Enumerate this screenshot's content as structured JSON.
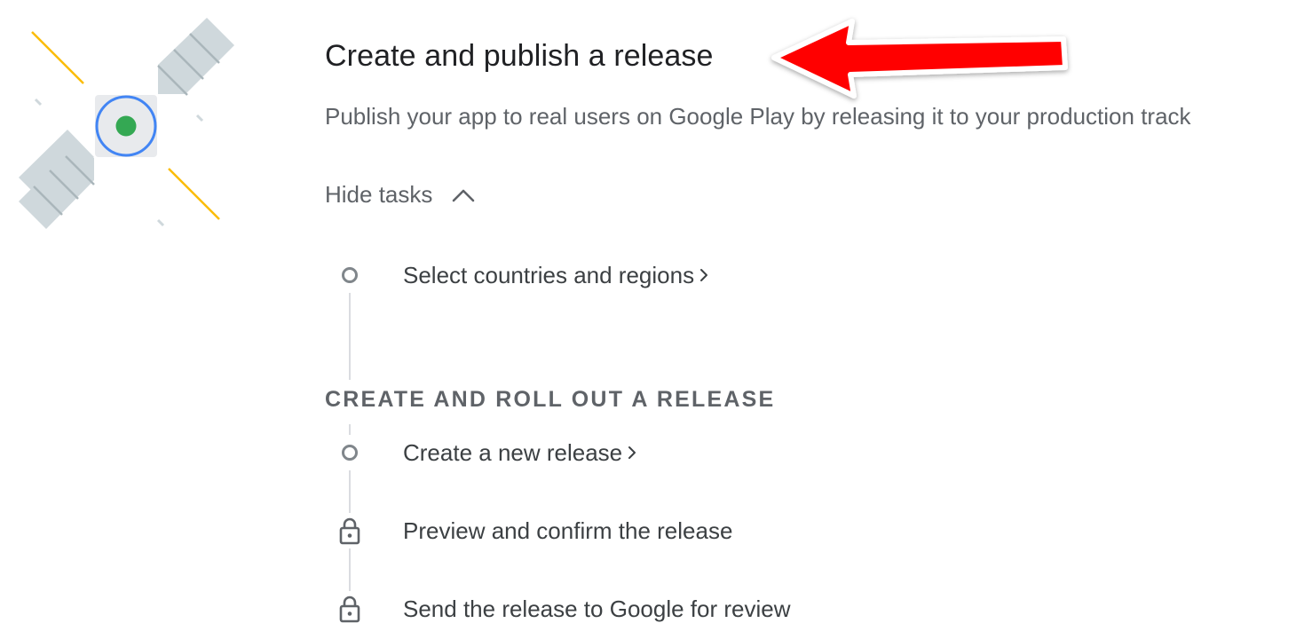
{
  "illustration": {
    "name": "satellite-illustration",
    "colors": {
      "panel": "#cfd8dc",
      "panel_line": "#aab6bb",
      "core_bg": "#e8eaed",
      "ring": "#4285f4",
      "dot": "#34a853",
      "ray": "#fbbc04"
    }
  },
  "header": {
    "title": "Create and publish a release",
    "subtitle": "Publish your app to real users on Google Play by releasing it to your production track"
  },
  "annotation": {
    "arrow_color": "#ff0000"
  },
  "toggle": {
    "label": "Hide tasks",
    "icon": "chevron-up-icon"
  },
  "tasks": {
    "countries": {
      "label": "Select countries and regions",
      "icon": "circle-outline-icon",
      "has_link_arrow": true
    },
    "section_title": "CREATE AND ROLL OUT A RELEASE",
    "new_release": {
      "label": "Create a new release",
      "icon": "circle-outline-icon",
      "has_link_arrow": true
    },
    "preview": {
      "label": "Preview and confirm the release",
      "icon": "lock-icon",
      "has_link_arrow": false
    },
    "send_review": {
      "label": "Send the release to Google for review",
      "icon": "lock-icon",
      "has_link_arrow": false
    }
  }
}
